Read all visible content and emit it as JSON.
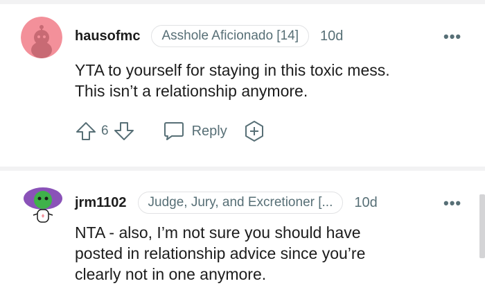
{
  "comments": [
    {
      "username": "hausofmc",
      "flair": "Asshole Aficionado [14]",
      "age": "10d",
      "body": [
        "YTA to yourself for staying in this toxic mess.",
        "This isn’t a relationship anymore."
      ],
      "votes": "6",
      "reply_label": "Reply",
      "avatar_color": "#f3909a"
    },
    {
      "username": "jrm1102",
      "flair": "Judge, Jury, and Excretioner [...",
      "age": "10d",
      "body": [
        "NTA - also, I’m not sure you should have",
        "posted in relationship advice since you’re",
        "clearly not in one anymore."
      ],
      "avatar_color": "#8a52b8"
    }
  ],
  "icons": {
    "more": "more-options-icon",
    "upvote": "upvote-arrow-icon",
    "downvote": "downvote-arrow-icon",
    "reply": "speech-bubble-icon",
    "award": "award-plus-icon"
  },
  "colors": {
    "text_primary": "#1c1c1c",
    "text_secondary": "#576f76",
    "divider": "#f2f2f3"
  },
  "more_glyph": "•••"
}
